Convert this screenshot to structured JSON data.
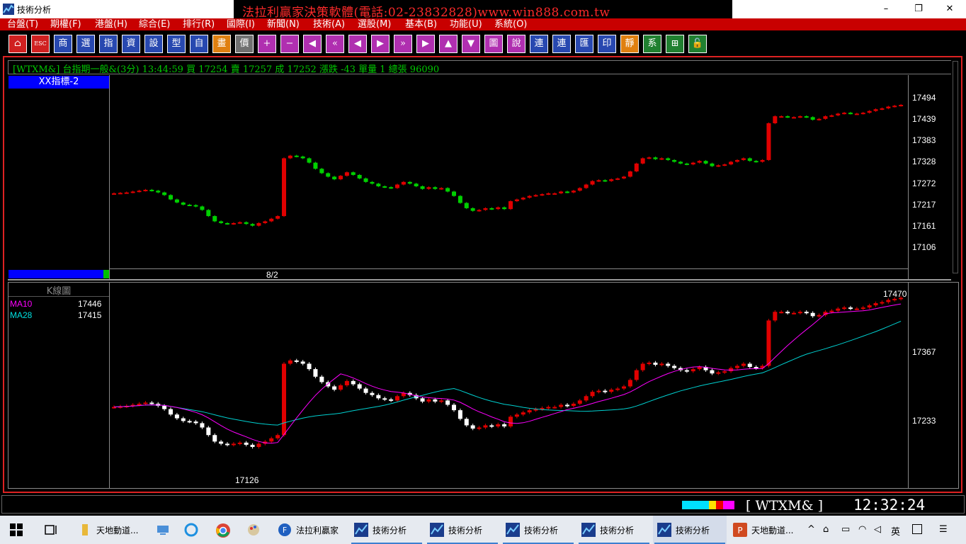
{
  "window": {
    "title": "技術分析",
    "banner": "法拉利贏家決策軟體(電話:02-23832828)www.win888.com.tw",
    "minimize_glyph": "–",
    "restore_glyph": "❐",
    "close_glyph": "✕"
  },
  "menu": [
    "台盤(T)",
    "期權(F)",
    "港盤(H)",
    "綜合(E)",
    "排行(R)",
    "國際(I)",
    "新聞(N)",
    "技術(A)",
    "選股(M)",
    "基本(B)",
    "功能(U)",
    "系統(O)"
  ],
  "toolbar": [
    {
      "label": "⌂",
      "icon": "home-icon"
    },
    {
      "label": "ESC",
      "icon": "esc-icon"
    },
    {
      "label": "商",
      "icon": "product-icon"
    },
    {
      "label": "選",
      "icon": "select-icon"
    },
    {
      "label": "指",
      "icon": "indicator-icon"
    },
    {
      "label": "資",
      "icon": "data-icon"
    },
    {
      "label": "設",
      "icon": "settings-icon"
    },
    {
      "label": "型",
      "icon": "pattern-icon"
    },
    {
      "label": "自",
      "icon": "custom-icon"
    },
    {
      "label": "畫",
      "icon": "draw-icon"
    },
    {
      "label": "價",
      "icon": "price-icon"
    },
    {
      "label": "+",
      "icon": "zoom-in-icon"
    },
    {
      "label": "−",
      "icon": "zoom-out-icon"
    },
    {
      "label": "◀",
      "icon": "left-end-icon"
    },
    {
      "label": "«",
      "icon": "fast-back-icon"
    },
    {
      "label": "◀",
      "icon": "back-icon"
    },
    {
      "label": "▶",
      "icon": "forward-icon"
    },
    {
      "label": "»",
      "icon": "fast-forward-icon"
    },
    {
      "label": "▶",
      "icon": "right-end-icon"
    },
    {
      "label": "▲",
      "icon": "up-icon"
    },
    {
      "label": "▼",
      "icon": "down-icon"
    },
    {
      "label": "圖",
      "icon": "chart-icon"
    },
    {
      "label": "說",
      "icon": "help-icon"
    },
    {
      "label": "連",
      "icon": "link-icon"
    },
    {
      "label": "連",
      "icon": "link2-icon"
    },
    {
      "label": "匯",
      "icon": "export-icon"
    },
    {
      "label": "印",
      "icon": "print-icon"
    },
    {
      "label": "靜",
      "icon": "static-icon"
    },
    {
      "label": "系",
      "icon": "system-icon"
    },
    {
      "label": "⊞",
      "icon": "layout-icon"
    },
    {
      "label": "🔓",
      "icon": "unlock-icon"
    }
  ],
  "quote": "[WTXM&] 台指期一般&(3分)  13:44:59 買 17254 賣 17257 成 17252 漲跌 -43 單量 1 總張 96090",
  "top_panel": {
    "indicator_title": "XX指標-2",
    "date_label": "8/2",
    "yaxis": [
      "17494",
      "17439",
      "17383",
      "17328",
      "17272",
      "17217",
      "17161",
      "17106"
    ]
  },
  "bottom_panel": {
    "title": "K線圖",
    "ma10_label": "MA10",
    "ma10_value": "17446",
    "ma28_label": "MA28",
    "ma28_value": "17415",
    "high_label": "17470",
    "low_label": "17126",
    "yaxis": [
      "17367",
      "17233"
    ]
  },
  "status": {
    "symbol": "[ WTXM&      ]",
    "time": "12:32:24"
  },
  "taskbar": {
    "items": [
      {
        "label": "天地動道...",
        "icon": "folder-icon"
      },
      {
        "label": "法拉利贏家",
        "icon": "ferrari-icon"
      },
      {
        "label": "技術分析",
        "icon": "chart-app-icon"
      },
      {
        "label": "技術分析",
        "icon": "chart-app-icon"
      },
      {
        "label": "技術分析",
        "icon": "chart-app-icon"
      },
      {
        "label": "技術分析",
        "icon": "chart-app-icon"
      },
      {
        "label": "技術分析",
        "icon": "chart-app-icon"
      },
      {
        "label": "天地動道...",
        "icon": "powerpoint-icon"
      }
    ],
    "ime": "英"
  },
  "chart_data": [
    {
      "type": "candlestick",
      "title": "XX指標-2",
      "ylim": [
        17080,
        17520
      ],
      "x_date_label": "8/2",
      "closes": [
        17250,
        17251,
        17252,
        17254,
        17256,
        17258,
        17256,
        17252,
        17246,
        17236,
        17229,
        17224,
        17223,
        17220,
        17212,
        17198,
        17186,
        17182,
        17180,
        17182,
        17184,
        17180,
        17176,
        17182,
        17186,
        17192,
        17198,
        17330,
        17336,
        17334,
        17330,
        17320,
        17306,
        17296,
        17288,
        17282,
        17290,
        17298,
        17292,
        17284,
        17276,
        17272,
        17266,
        17264,
        17262,
        17270,
        17276,
        17272,
        17266,
        17260,
        17264,
        17260,
        17262,
        17254,
        17244,
        17228,
        17216,
        17210,
        17212,
        17216,
        17214,
        17218,
        17214,
        17232,
        17236,
        17240,
        17244,
        17246,
        17248,
        17250,
        17250,
        17254,
        17252,
        17256,
        17262,
        17270,
        17278,
        17280,
        17278,
        17282,
        17284,
        17288,
        17300,
        17318,
        17330,
        17332,
        17328,
        17330,
        17326,
        17322,
        17318,
        17316,
        17320,
        17324,
        17318,
        17312,
        17314,
        17316,
        17322,
        17326,
        17330,
        17324,
        17322,
        17326,
        17410,
        17426,
        17426,
        17424,
        17424,
        17426,
        17424,
        17418,
        17420,
        17426,
        17428,
        17432,
        17434,
        17432,
        17432,
        17434,
        17438,
        17442,
        17444,
        17448,
        17450,
        17452
      ]
    },
    {
      "type": "candlestick",
      "title": "K線圖",
      "series": [
        {
          "name": "MA10"
        },
        {
          "name": "MA28"
        }
      ],
      "ylim": [
        17100,
        17480
      ],
      "high": 17470,
      "low": 17126
    }
  ]
}
